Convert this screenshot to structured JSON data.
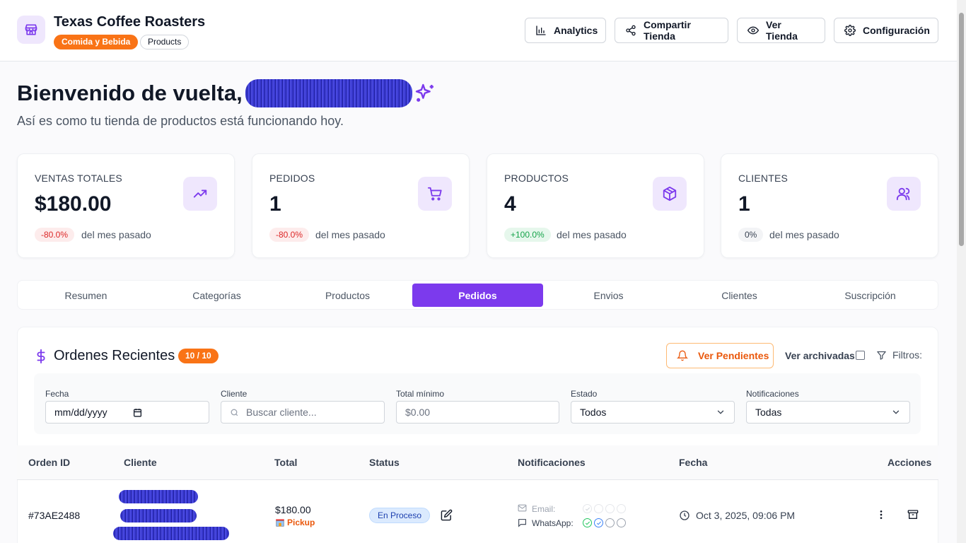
{
  "header": {
    "store_name": "Texas Coffee Roasters",
    "category_badge": "Comida y Bebida",
    "type_badge": "Products",
    "buttons": {
      "analytics": "Analytics",
      "share": "Compartir Tienda",
      "view": "Ver Tienda",
      "settings": "Configuración"
    }
  },
  "welcome": {
    "greeting": "Bienvenido de vuelta,",
    "subtitle": "Así es como tu tienda de productos está funcionando hoy."
  },
  "stats": [
    {
      "label": "VENTAS TOTALES",
      "value": "$180.00",
      "change": "-80.0%",
      "note": "del mes pasado",
      "icon": "trending-up-icon"
    },
    {
      "label": "PEDIDOS",
      "value": "1",
      "change": "-80.0%",
      "note": "del mes pasado",
      "icon": "shopping-cart-icon"
    },
    {
      "label": "PRODUCTOS",
      "value": "4",
      "change": "+100.0%",
      "note": "del mes pasado",
      "icon": "package-icon"
    },
    {
      "label": "CLIENTES",
      "value": "1",
      "change": "0%",
      "note": "del mes pasado",
      "icon": "users-icon"
    }
  ],
  "tabs": [
    "Resumen",
    "Categorías",
    "Productos",
    "Pedidos",
    "Envios",
    "Clientes",
    "Suscripción"
  ],
  "active_tab": "Pedidos",
  "orders": {
    "title": "Ordenes Recientes",
    "count_badge": "10 / 10",
    "pending_button": "Ver Pendientes",
    "archived_label": "Ver archivadas",
    "filters_label": "Filtros:",
    "filters": {
      "date_label": "Fecha",
      "date_placeholder": "mm/dd/yyyy",
      "client_label": "Cliente",
      "client_placeholder": "Buscar cliente...",
      "min_total_label": "Total mínimo",
      "min_total_placeholder": "$0.00",
      "status_label": "Estado",
      "status_value": "Todos",
      "notif_label": "Notificaciones",
      "notif_value": "Todas"
    },
    "columns": [
      "Orden ID",
      "Cliente",
      "Total",
      "Status",
      "Notificaciones",
      "Fecha",
      "Acciones"
    ],
    "rows": [
      {
        "id": "#73AE2488",
        "total": "$180.00",
        "delivery": "Pickup",
        "status": "En Proceso",
        "email_label": "Email:",
        "whatsapp_label": "WhatsApp:",
        "date": "Oct 3, 2025, 09:06 PM"
      }
    ]
  },
  "colors": {
    "accent": "#7c3aed",
    "orange": "#f97316",
    "negative": "#dc2626",
    "positive": "#16a34a"
  }
}
